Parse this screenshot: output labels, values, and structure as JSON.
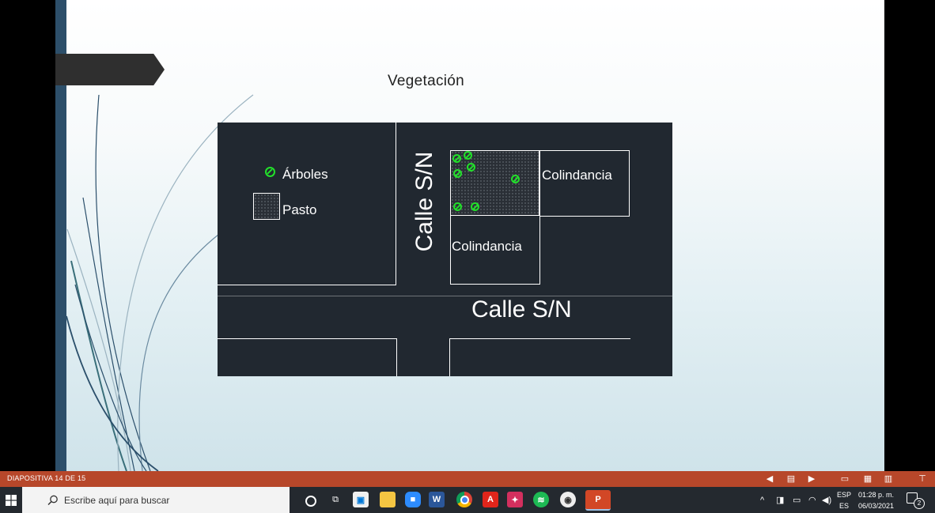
{
  "slide": {
    "title": "Vegetación",
    "diagram": {
      "legend": {
        "trees_label": "Árboles",
        "grass_label": "Pasto"
      },
      "street_vertical_label": "Calle S/N",
      "street_horizontal_label": "Calle S/N",
      "neighbor_right_label": "Colindancia",
      "neighbor_bottom_label": "Colindancia"
    }
  },
  "statusbar": {
    "slide_indicator": "DIAPOSITIVA 14 DE 15"
  },
  "taskbar": {
    "search_placeholder": "Escribe aquí para buscar",
    "apps": [
      "cortana-icon",
      "task-view-icon",
      "store-icon",
      "file-explorer-icon",
      "zoom-icon",
      "word-icon",
      "chrome-icon",
      "acrobat-icon",
      "app-icon",
      "spotify-icon",
      "app2-icon",
      "powerpoint-icon"
    ]
  },
  "tray": {
    "lang_top": "ESP",
    "lang_bottom": "ES",
    "time": "01:28 p. m.",
    "date": "06/03/2021",
    "notifications_count": "2"
  },
  "colors": {
    "statusbar": "#b7472a",
    "taskbar": "#24292f",
    "tree_green": "#22e02a",
    "cad_bg": "#212830"
  }
}
